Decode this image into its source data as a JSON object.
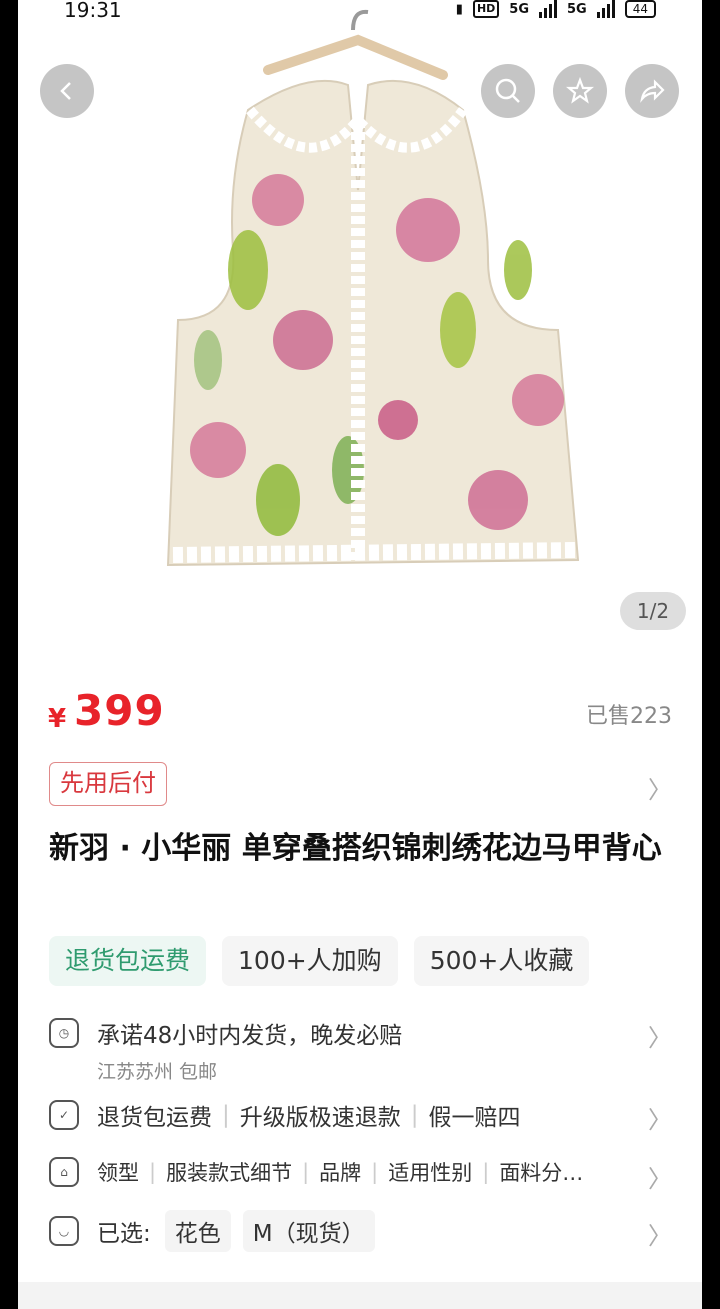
{
  "status_bar": {
    "time": "19:31",
    "network_hd": "HD",
    "network_a": "5G",
    "network_b": "5G",
    "battery": "44"
  },
  "gallery": {
    "counter": "1/2"
  },
  "product": {
    "currency": "¥",
    "price": "399",
    "sold": "已售223",
    "pay_later": "先用后付",
    "title": "新羽 · 小华丽 单穿叠搭织锦刺绣花边马甲背心"
  },
  "chips": [
    "退货包运费",
    "100+人加购",
    "500+人收藏"
  ],
  "shipping": {
    "promise": "承诺48小时内发货，晚发必赔",
    "origin": "江苏苏州 包邮"
  },
  "guarantees": [
    "退货包运费",
    "升级版极速退款",
    "假一赔四"
  ],
  "params": [
    "领型",
    "服装款式细节",
    "品牌",
    "适用性别",
    "面料分…"
  ],
  "selected": {
    "label": "已选:",
    "options": [
      "花色",
      "M（现货）"
    ]
  },
  "colors": {
    "accent": "#e8232a",
    "green": "#2f9b6f"
  }
}
